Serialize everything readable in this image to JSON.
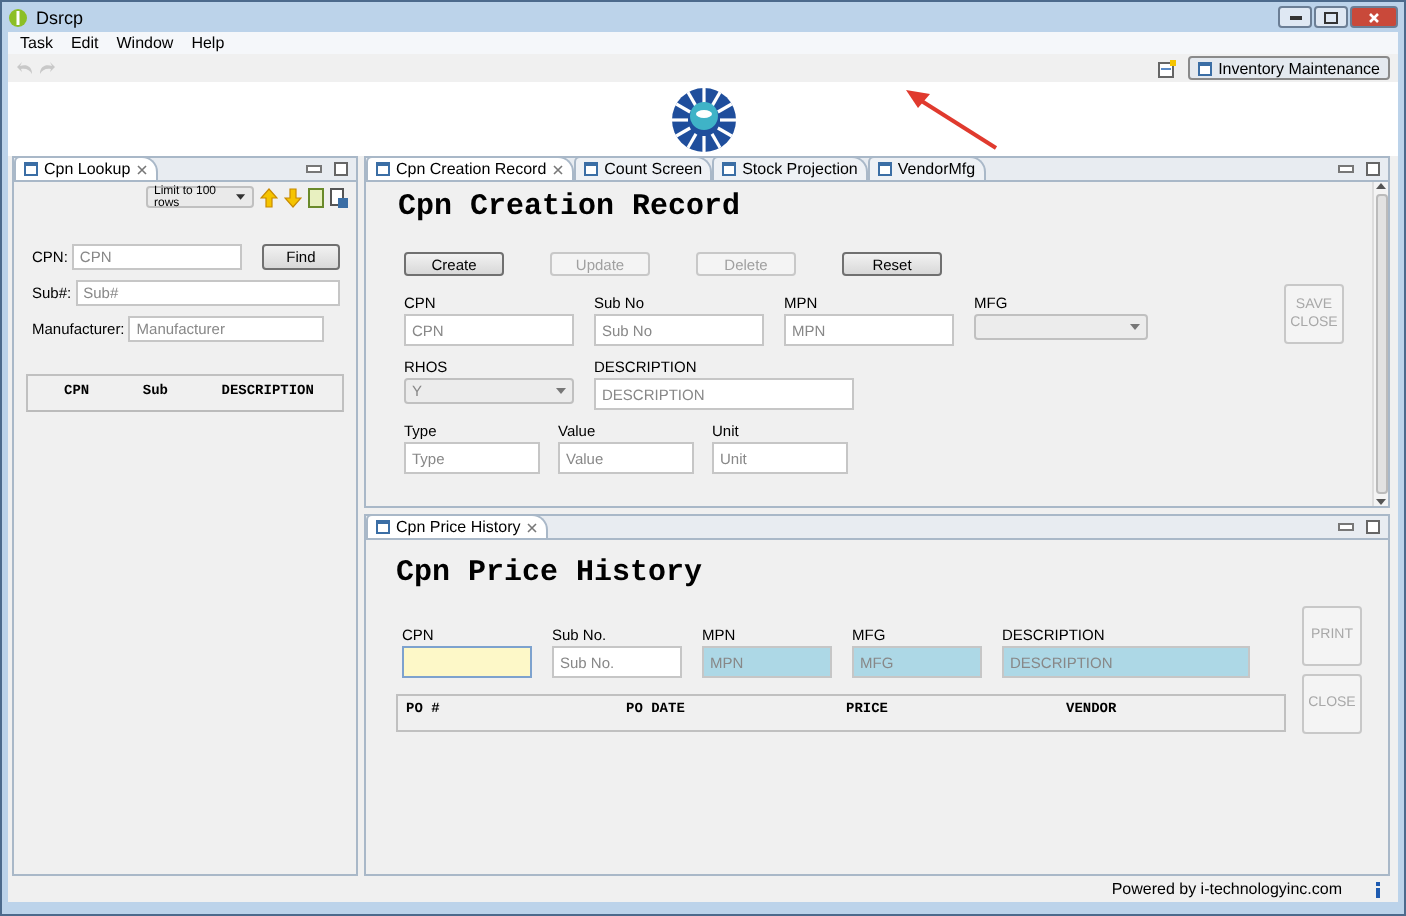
{
  "window": {
    "title": "Dsrcp"
  },
  "menu": [
    "Task",
    "Edit",
    "Window",
    "Help"
  ],
  "perspective": {
    "label": "Inventory Maintenance",
    "selected": true
  },
  "lookup": {
    "tab": {
      "label": "Cpn Lookup",
      "selected": true
    },
    "limit": "Limit to 100 rows",
    "find": "Find",
    "fields": [
      {
        "label": "CPN:",
        "placeholder": "CPN"
      },
      {
        "label": "Sub#:",
        "placeholder": "Sub#"
      },
      {
        "label": "Manufacturer:",
        "placeholder": "Manufacturer"
      }
    ],
    "columns": [
      "CPN",
      "Sub",
      "DESCRIPTION"
    ]
  },
  "editor_tabs": [
    {
      "label": "Cpn Creation Record",
      "selected": true
    },
    {
      "label": "Count Screen",
      "selected": false
    },
    {
      "label": "Stock Projection",
      "selected": false
    },
    {
      "label": "VendorMfg",
      "selected": false
    }
  ],
  "creation": {
    "title": "Cpn Creation Record",
    "buttons": [
      {
        "label": "Create",
        "disabled": false
      },
      {
        "label": "Update",
        "disabled": true
      },
      {
        "label": "Delete",
        "disabled": true
      },
      {
        "label": "Reset",
        "disabled": false
      }
    ],
    "rows": [
      {
        "fields": [
          {
            "label": "CPN",
            "kind": "text",
            "placeholder": "CPN"
          },
          {
            "label": "Sub No",
            "kind": "text",
            "placeholder": "Sub No"
          },
          {
            "label": "MPN",
            "kind": "text",
            "placeholder": "MPN"
          },
          {
            "label": "MFG",
            "kind": "combo",
            "disabled": true
          }
        ]
      },
      {
        "fields": [
          {
            "label": "RHOS",
            "kind": "combo",
            "value": "Y",
            "disabled": true
          },
          {
            "label": "DESCRIPTION",
            "kind": "wide",
            "placeholder": "DESCRIPTION"
          }
        ]
      },
      {
        "fields": [
          {
            "label": "Type",
            "kind": "short",
            "placeholder": "Type"
          },
          {
            "label": "Value",
            "kind": "short",
            "placeholder": "Value"
          },
          {
            "label": "Unit",
            "kind": "short",
            "placeholder": "Unit"
          }
        ]
      }
    ],
    "save_close": {
      "label": "SAVE CLOSE",
      "disabled": true
    }
  },
  "history": {
    "tab": {
      "label": "Cpn Price History",
      "selected": true
    },
    "title": "Cpn Price History",
    "fields": [
      {
        "label": "CPN",
        "kind": "focused"
      },
      {
        "label": "Sub No.",
        "kind": "text",
        "placeholder": "Sub No."
      },
      {
        "label": "MPN",
        "kind": "readonly",
        "placeholder": "MPN"
      },
      {
        "label": "MFG",
        "kind": "readonly",
        "placeholder": "MFG"
      },
      {
        "label": "DESCRIPTION",
        "kind": "readonly_wide",
        "placeholder": "DESCRIPTION"
      }
    ],
    "columns": [
      "PO #",
      "PO DATE",
      "PRICE",
      "VENDOR"
    ],
    "buttons": [
      {
        "label": "PRINT",
        "disabled": true
      },
      {
        "label": "CLOSE",
        "disabled": true
      }
    ]
  },
  "status": "Powered by i-technologyinc.com"
}
